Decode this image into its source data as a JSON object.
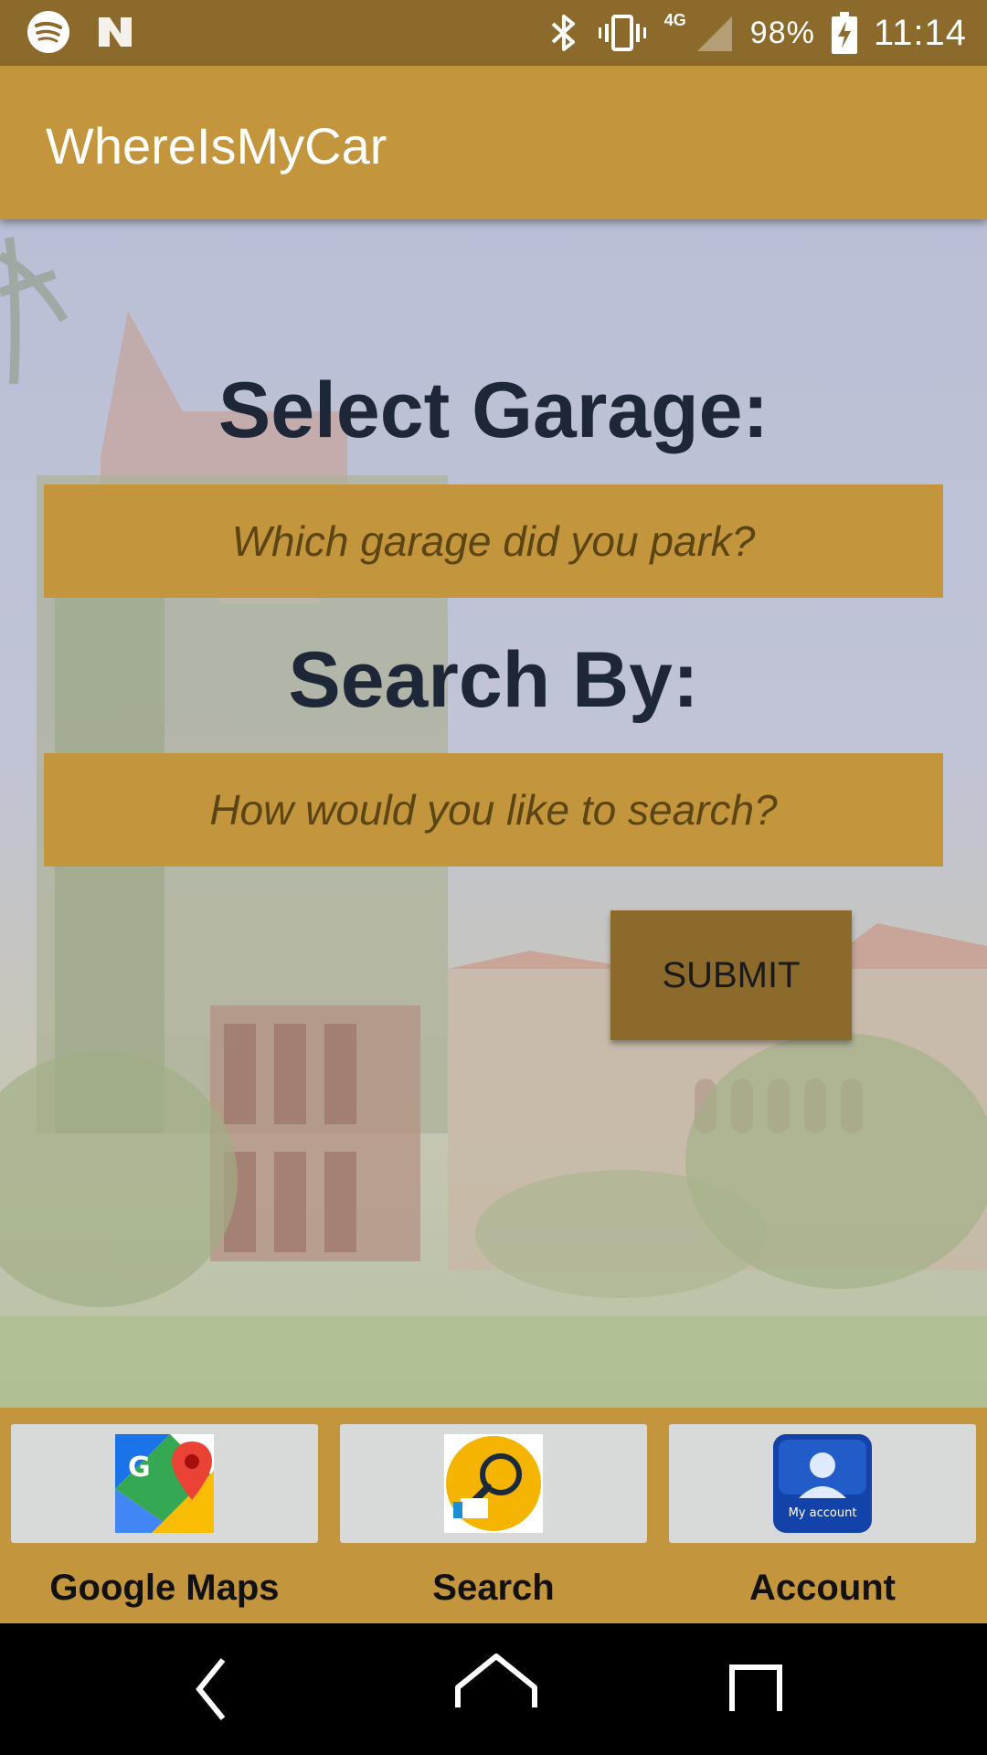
{
  "status_bar": {
    "network": "4G",
    "battery_percent": "98%",
    "time": "11:14",
    "icons": [
      "spotify-icon",
      "nfc-icon",
      "bluetooth-icon",
      "vibrate-icon",
      "signal-icon",
      "battery-charging-icon"
    ]
  },
  "app_bar": {
    "title": "WhereIsMyCar"
  },
  "main": {
    "garage_heading": "Select Garage:",
    "garage_placeholder": "Which garage did you park?",
    "search_heading": "Search By:",
    "search_placeholder": "How would you like to search?",
    "submit_label": "SUBMIT"
  },
  "bottom_nav": {
    "items": [
      {
        "label": "Google Maps",
        "icon": "google-maps-icon"
      },
      {
        "label": "Search",
        "icon": "search-magnifier-icon"
      },
      {
        "label": "Account",
        "icon": "my-account-icon",
        "icon_text": "My account"
      }
    ]
  },
  "system_nav": {
    "icons": [
      "back-icon",
      "home-icon",
      "recents-icon"
    ]
  },
  "colors": {
    "primary": "#c3953d",
    "primary_dark": "#8c6a2b",
    "heading_text": "#1e2737"
  }
}
